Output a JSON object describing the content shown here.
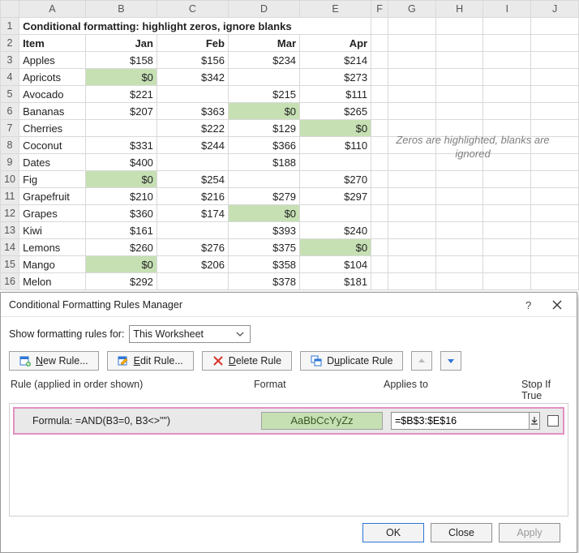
{
  "columns": [
    "A",
    "B",
    "C",
    "D",
    "E",
    "F",
    "G",
    "H",
    "I",
    "J"
  ],
  "title": "Conditional formatting: highlight zeros, ignore blanks",
  "headers": {
    "item": "Item",
    "months": [
      "Jan",
      "Feb",
      "Mar",
      "Apr"
    ]
  },
  "rows": [
    {
      "n": "Apples",
      "v": [
        "$158",
        "$156",
        "$234",
        "$214"
      ],
      "hl": []
    },
    {
      "n": "Apricots",
      "v": [
        "$0",
        "$342",
        "",
        "$273"
      ],
      "hl": [
        0
      ]
    },
    {
      "n": "Avocado",
      "v": [
        "$221",
        "",
        "$215",
        "$111"
      ],
      "hl": []
    },
    {
      "n": "Bananas",
      "v": [
        "$207",
        "$363",
        "$0",
        "$265"
      ],
      "hl": [
        2
      ]
    },
    {
      "n": "Cherries",
      "v": [
        "",
        "$222",
        "$129",
        "$0"
      ],
      "hl": [
        3
      ]
    },
    {
      "n": "Coconut",
      "v": [
        "$331",
        "$244",
        "$366",
        "$110"
      ],
      "hl": []
    },
    {
      "n": "Dates",
      "v": [
        "$400",
        "",
        "$188",
        ""
      ],
      "hl": []
    },
    {
      "n": "Fig",
      "v": [
        "$0",
        "$254",
        "",
        "$270"
      ],
      "hl": [
        0
      ]
    },
    {
      "n": "Grapefruit",
      "v": [
        "$210",
        "$216",
        "$279",
        "$297"
      ],
      "hl": []
    },
    {
      "n": "Grapes",
      "v": [
        "$360",
        "$174",
        "$0",
        ""
      ],
      "hl": [
        2
      ]
    },
    {
      "n": "Kiwi",
      "v": [
        "$161",
        "",
        "$393",
        "$240"
      ],
      "hl": []
    },
    {
      "n": "Lemons",
      "v": [
        "$260",
        "$276",
        "$375",
        "$0"
      ],
      "hl": [
        3
      ]
    },
    {
      "n": "Mango",
      "v": [
        "$0",
        "$206",
        "$358",
        "$104"
      ],
      "hl": [
        0
      ]
    },
    {
      "n": "Melon",
      "v": [
        "$292",
        "",
        "$378",
        "$181"
      ],
      "hl": []
    }
  ],
  "note": "Zeros are highlighted, blanks are ignored",
  "dialog": {
    "title": "Conditional Formatting Rules Manager",
    "show_label": "Show formatting rules for:",
    "show_value": "This Worksheet",
    "buttons": {
      "new": "New Rule...",
      "edit": "Edit Rule...",
      "delete": "Delete Rule",
      "duplicate": "Duplicate Rule"
    },
    "cols": {
      "rule": "Rule (applied in order shown)",
      "format": "Format",
      "applies": "Applies to",
      "stop": "Stop If True"
    },
    "rule": {
      "label": "Formula: =AND(B3=0, B3<>\"\")",
      "preview": "AaBbCcYyZz",
      "applies": "=$B$3:$E$16"
    },
    "footer": {
      "ok": "OK",
      "close": "Close",
      "apply": "Apply"
    }
  }
}
